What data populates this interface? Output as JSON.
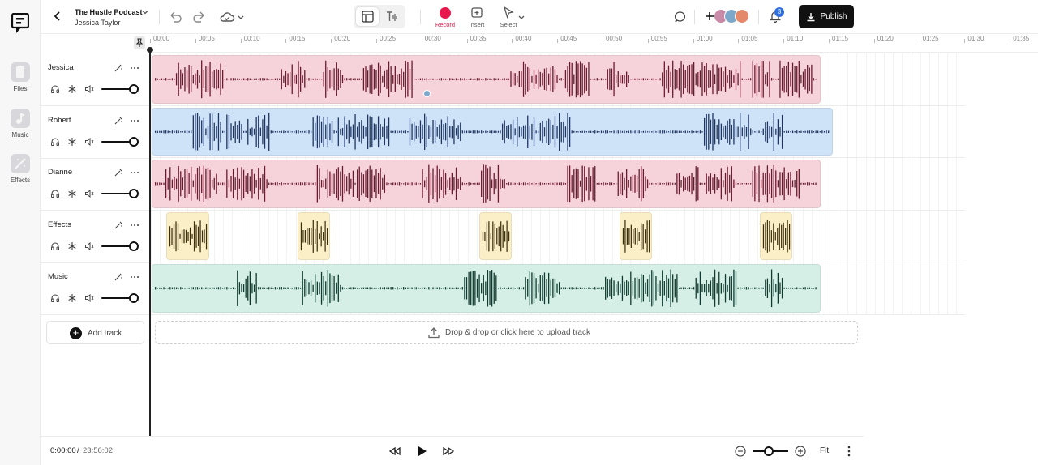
{
  "header": {
    "project_title": "The Hustle Podcast",
    "user_name": "Jessica Taylor",
    "tools": [
      {
        "id": "record",
        "label": "Record"
      },
      {
        "id": "insert",
        "label": "Insert"
      },
      {
        "id": "select",
        "label": "Select"
      }
    ],
    "notification_count": "3",
    "publish_label": "Publish"
  },
  "sidebar": {
    "items": [
      {
        "label": "Files"
      },
      {
        "label": "Music"
      },
      {
        "label": "Effects"
      }
    ]
  },
  "ruler_ticks": [
    "00:00",
    "00:05",
    "00:10",
    "00:15",
    "00:20",
    "00:25",
    "00:30",
    "00:35",
    "00:40",
    "00:45",
    "00:50",
    "00:55",
    "01:00",
    "01:05",
    "01:10",
    "01:15",
    "01:20",
    "01:25",
    "01:30",
    "01:35"
  ],
  "tracks": [
    {
      "name": "Jessica",
      "volume": 1.0,
      "color": "#f6d3db",
      "wave": "#6b1a2e"
    },
    {
      "name": "Robert",
      "volume": 1.0,
      "color": "#cfe3f8",
      "wave": "#1e3564"
    },
    {
      "name": "Dianne",
      "volume": 1.0,
      "color": "#f6d3db",
      "wave": "#6b1a2e"
    },
    {
      "name": "Effects",
      "volume": 1.0,
      "color": "#fbefc7",
      "wave": "#3d2f0c"
    },
    {
      "name": "Music",
      "volume": 1.0,
      "color": "#d5efe6",
      "wave": "#0f3b2e"
    }
  ],
  "add_track_label": "Add track",
  "upload_label": "Drop & drop or click here to upload track",
  "footer": {
    "current_time": "0:00:00",
    "separator": "/",
    "total_time": "23:56:02",
    "fit_label": "Fit"
  },
  "colors": {
    "record": "#e8174d",
    "badge": "#2f6fe0",
    "publish_bg": "#111111"
  }
}
